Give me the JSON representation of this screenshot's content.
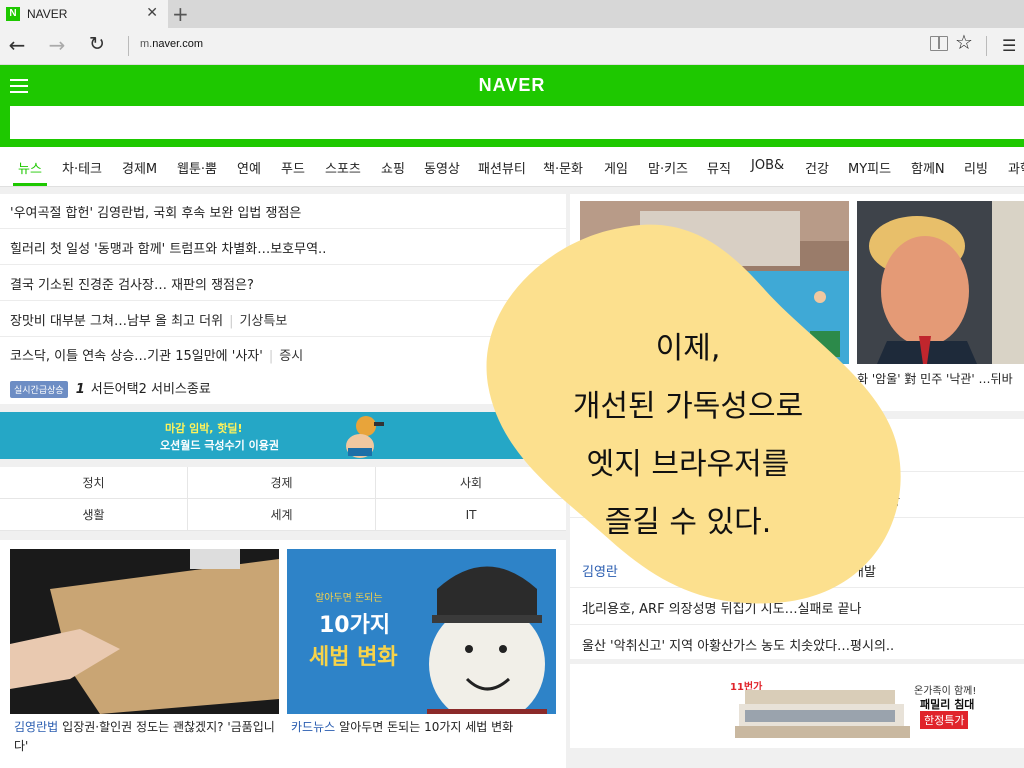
{
  "browser": {
    "tab_title": "NAVER",
    "favicon_letter": "N",
    "url_prefix": "m.",
    "url_host": "naver.com"
  },
  "header": {
    "logo": "NAVER"
  },
  "categories": [
    "뉴스",
    "차·테크",
    "경제M",
    "웹툰·뿜",
    "연예",
    "푸드",
    "스포츠",
    "쇼핑",
    "동영상",
    "패션뷰티",
    "책·문화",
    "게임",
    "맘·키즈",
    "뮤직",
    "JOB&",
    "건강",
    "MY피드",
    "함께N",
    "리빙",
    "과학"
  ],
  "headlines": {
    "items": [
      "'우여곡절 합헌' 김영란법, 국회 후속 보완 입법 쟁점은",
      "힐러리 첫 일성 '동맹과 함께' 트럼프와 차별화…보호무역..",
      "결국 기소된 진경준 검사장… 재판의 쟁점은?"
    ],
    "item4_main": "장맛비 대부분 그쳐…남부 올 최고 더위",
    "item4_sub": "기상특보",
    "item5_main": "코스닥, 이틀 연속 상승…기관 15일만에 '사자'",
    "item5_sub": "증시",
    "realtime_badge": "실시간급상승",
    "realtime_rank": "1",
    "realtime_text": "서든어택2 서비스종료"
  },
  "banner": {
    "line1": "마감 임박, 핫딜!",
    "line2": "오션월드 극성수기 이용권"
  },
  "grid": [
    "정치",
    "경제",
    "사회",
    "생활",
    "세계",
    "IT"
  ],
  "cards": {
    "card1_source": "김영란법",
    "card1_text": "입장권·할인권 정도는 괜찮겠지? '금품입니다'",
    "card2_source": "카드뉴스",
    "card2_text": "알아두면 돈되는 10가지 세법 변화",
    "card2_img_small": "알아두면 돈되는",
    "card2_img_line1": "10가지",
    "card2_img_line2": "세법 변화"
  },
  "right": {
    "img2_caption": "화 '암울' 對 민주 '낙관' …뒤바",
    "list_item_a": "방",
    "list_item_b_blue": "김영란",
    "list_item_b_rest": "권 메뉴 개발",
    "list_item_c": "北리용호, ARF 의장성명 뒤집기 시도…실패로 끝나",
    "list_item_d": "울산 '악취신고' 지역 아황산가스 농도 치솟았다…평시의.."
  },
  "ad": {
    "tag": "11번가",
    "line1": "온가족이 함께!",
    "line2": "패밀리 침대",
    "line3": "한정특가"
  },
  "overlay": {
    "line1": "이제,",
    "line2": "개선된 가독성으로",
    "line3": "엣지 브라우저를",
    "line4": "즐길 수 있다.",
    "color": "#fce08e"
  },
  "colors": {
    "naver_green": "#1ec800",
    "link_blue": "#2a5db0"
  }
}
